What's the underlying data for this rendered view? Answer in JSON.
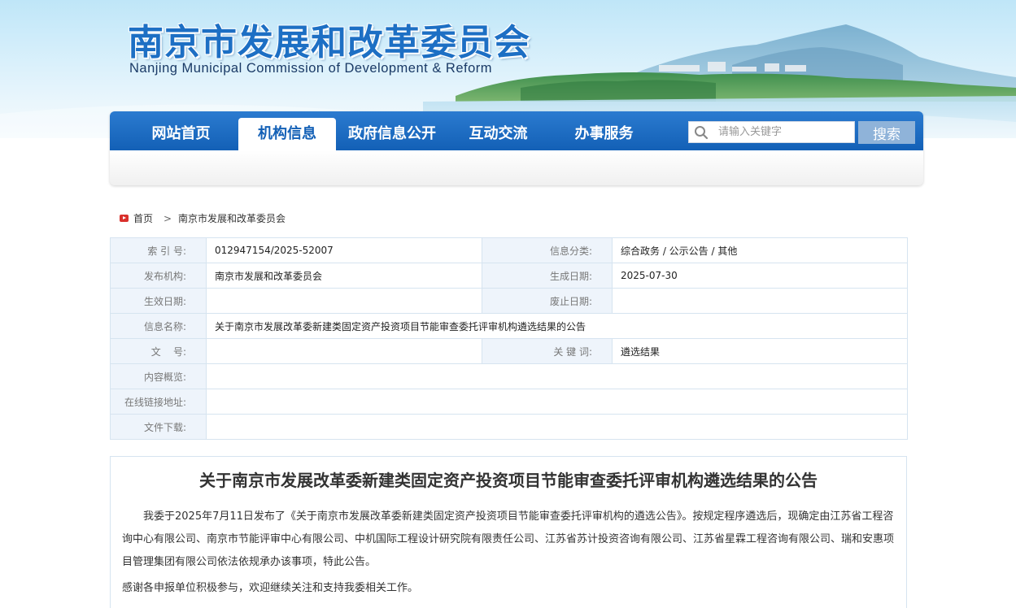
{
  "header": {
    "title": "南京市发展和改革委员会",
    "subtitle": "Nanjing Municipal Commission of Development & Reform"
  },
  "nav": {
    "items": [
      {
        "label": "网站首页",
        "active": false
      },
      {
        "label": "机构信息",
        "active": true
      },
      {
        "label": "政府信息公开",
        "active": false
      },
      {
        "label": "互动交流",
        "active": false
      },
      {
        "label": "办事服务",
        "active": false
      }
    ],
    "search": {
      "placeholder": "请输入关键字",
      "button_label": "搜索",
      "icon": "search-icon"
    }
  },
  "breadcrumb": {
    "home": "首页",
    "separator": ">",
    "current": "南京市发展和改革委员会",
    "home_icon": "home-icon"
  },
  "info": {
    "index_label": "索 引 号:",
    "index_value": "012947154/2025-52007",
    "category_label": "信息分类:",
    "category_value": "综合政务 / 公示公告 / 其他",
    "publisher_label": "发布机构:",
    "publisher_value": "南京市发展和改革委员会",
    "created_label": "生成日期:",
    "created_value": "2025-07-30",
    "effective_label": "生效日期:",
    "effective_value": "",
    "expire_label": "废止日期:",
    "expire_value": "",
    "name_label": "信息名称:",
    "name_value": "关于南京市发展改革委新建类固定资产投资项目节能审查委托评审机构遴选结果的公告",
    "docno_label": "文    号:",
    "docno_value": "",
    "keyword_label": "关 键 词:",
    "keyword_value": "遴选结果",
    "summary_label": "内容概览:",
    "summary_value": "",
    "link_label": "在线链接地址:",
    "link_value": "",
    "download_label": "文件下载:",
    "download_value": ""
  },
  "article": {
    "title": "关于南京市发展改革委新建类固定资产投资项目节能审查委托评审机构遴选结果的公告",
    "paragraph1": "我委于2025年7月11日发布了《关于南京市发展改革委新建类固定资产投资项目节能审查委托评审机构的遴选公告》。按规定程序遴选后，现确定由江苏省工程咨询中心有限公司、南京市节能评审中心有限公司、中机国际工程设计研究院有限责任公司、江苏省苏计投资咨询有限公司、江苏省星霖工程咨询有限公司、瑞和安惠项目管理集团有限公司依法依规承办该事项，特此公告。",
    "paragraph2": "感谢各申报单位积极参与，欢迎继续关注和支持我委相关工作。"
  },
  "colors": {
    "nav_blue": "#1360b6",
    "title_blue": "#1d6fc4",
    "label_bg": "#eef4fb",
    "border": "#d6e4f0",
    "search_button": "#8fb3d9"
  }
}
